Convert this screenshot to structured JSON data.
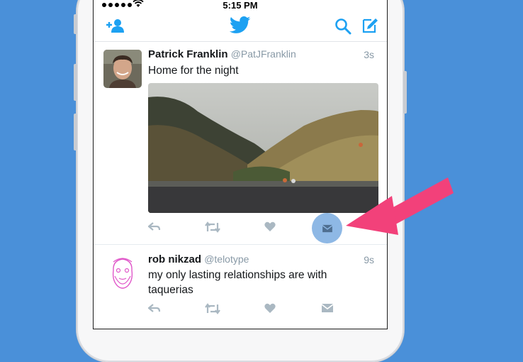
{
  "status_bar": {
    "time": "5:15 PM"
  },
  "navbar": {
    "icons": [
      "add-follower-icon",
      "twitter-bird-icon",
      "search-icon",
      "compose-icon"
    ]
  },
  "tweets": [
    {
      "name": "Patrick Franklin",
      "handle": "@PatJFranklin",
      "time": "3s",
      "text": "Home for the night",
      "has_media": true
    },
    {
      "name": "rob nikzad",
      "handle": "@telotype",
      "time": "9s",
      "text": "my only lasting relationships are with taquerias",
      "has_media": false
    }
  ],
  "colors": {
    "background": "#4a90d9",
    "twitter_blue": "#1da1f2",
    "dm_highlight": "#8eb8e5",
    "arrow": "#f2417a"
  }
}
